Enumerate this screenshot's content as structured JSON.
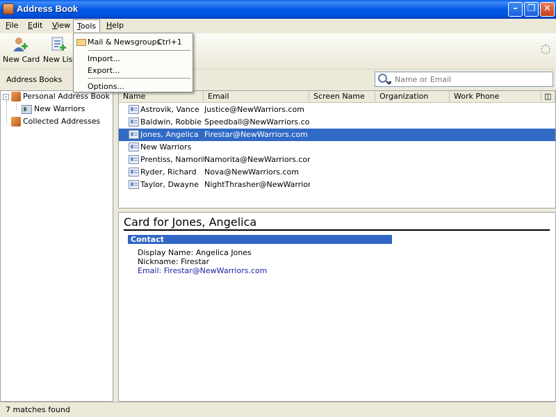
{
  "window": {
    "title": "Address Book"
  },
  "menubar": {
    "items": [
      {
        "label": "File",
        "key": "F",
        "rest": "ile"
      },
      {
        "label": "Edit",
        "key": "E",
        "rest": "dit"
      },
      {
        "label": "View",
        "key": "V",
        "rest": "iew"
      },
      {
        "label": "Tools",
        "key": "T",
        "rest": "ools"
      },
      {
        "label": "Help",
        "key": "H",
        "rest": "elp"
      }
    ]
  },
  "toolbar": {
    "new_card": "New Card",
    "new_list": "New List"
  },
  "address_books_label": "Address Books",
  "search": {
    "placeholder": "Name or Email"
  },
  "tree": {
    "personal": "Personal Address Book",
    "new_warriors": "New Warriors",
    "collected": "Collected Addresses"
  },
  "columns": {
    "name": "Name",
    "email": "Email",
    "screen_name": "Screen Name",
    "organization": "Organization",
    "work_phone": "Work Phone"
  },
  "rows": [
    {
      "name": "Astrovik, Vance",
      "email": "Justice@NewWarriors.com"
    },
    {
      "name": "Baldwin, Robbie",
      "email": "Speedball@NewWarriors.com"
    },
    {
      "name": "Jones, Angelica",
      "email": "Firestar@NewWarriors.com"
    },
    {
      "name": "New Warriors",
      "email": ""
    },
    {
      "name": "Prentiss, Namorita",
      "email": "Namorita@NewWarriors.com"
    },
    {
      "name": "Ryder, Richard",
      "email": "Nova@NewWarriors.com"
    },
    {
      "name": "Taylor, Dwayne",
      "email": "NightThrasher@NewWarrior…"
    }
  ],
  "card": {
    "title": "Card for Jones, Angelica",
    "section": "Contact",
    "display_name": "Display Name: Angelica Jones",
    "nickname": "Nickname: Firestar",
    "email": "Email: Firestar@NewWarriors.com"
  },
  "status": "7 matches found",
  "tools_menu": {
    "mail_label": "Mail & Newsgroups",
    "mail_shortcut": "Ctrl+1",
    "import": "Import...",
    "export": "Export...",
    "options": "Options..."
  },
  "colors": {
    "selection": "#316ac5",
    "titlebar": "#0058e6",
    "section_head": "#3166c4"
  }
}
